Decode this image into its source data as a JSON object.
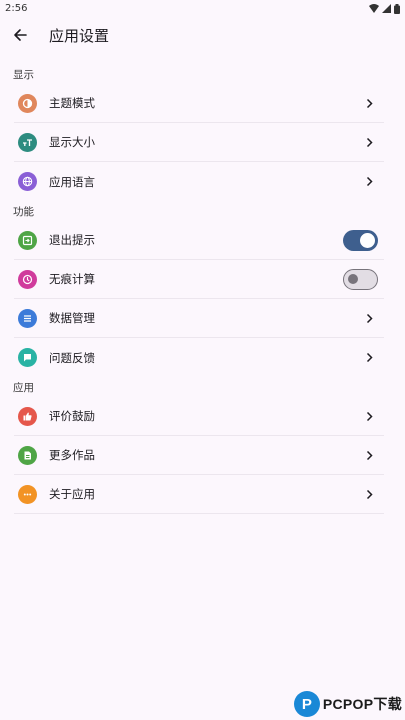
{
  "status_bar": {
    "time": "2:56"
  },
  "app_bar": {
    "title": "应用设置"
  },
  "sections": {
    "display": {
      "header": "显示"
    },
    "function": {
      "header": "功能"
    },
    "app": {
      "header": "应用"
    }
  },
  "items": {
    "theme": {
      "label": "主题模式",
      "icon": "theme-contrast-icon",
      "color": "#e0875c"
    },
    "size": {
      "label": "显示大小",
      "icon": "text-size-icon",
      "color": "#2d8c80"
    },
    "language": {
      "label": "应用语言",
      "icon": "globe-icon",
      "color": "#8a5fd6"
    },
    "exit_tip": {
      "label": "退出提示",
      "icon": "exit-icon",
      "color": "#4fa546",
      "toggle": true
    },
    "incognito": {
      "label": "无痕计算",
      "icon": "clock-icon",
      "color": "#d03b9c",
      "toggle": false
    },
    "data": {
      "label": "数据管理",
      "icon": "list-icon",
      "color": "#3c7bd9"
    },
    "feedback": {
      "label": "问题反馈",
      "icon": "chat-icon",
      "color": "#29b3a4"
    },
    "rate": {
      "label": "评价鼓励",
      "icon": "thumb-up-icon",
      "color": "#e5574b"
    },
    "more": {
      "label": "更多作品",
      "icon": "store-icon",
      "color": "#4fa546"
    },
    "about": {
      "label": "关于应用",
      "icon": "more-dots-icon",
      "color": "#f29325"
    }
  },
  "watermark": {
    "text": "PCPOP下载",
    "logo_letter": "P"
  },
  "colors": {
    "background": "#fcf7fd",
    "switch_on": "#3e5f8e",
    "switch_off": "#e2dde4"
  }
}
